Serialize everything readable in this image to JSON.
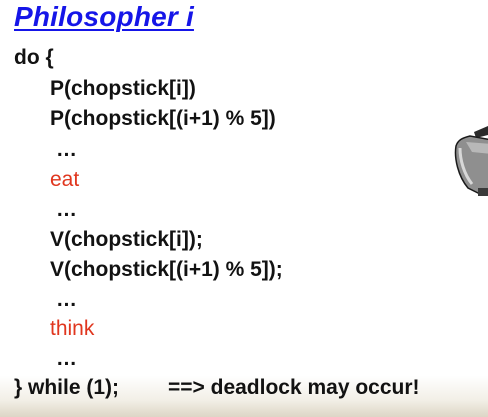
{
  "slide": {
    "title": "Philosopher i",
    "code": [
      {
        "text": "do {",
        "style": "code"
      },
      {
        "text": "P(chopstick[i])",
        "style": "code"
      },
      {
        "text": "P(chopstick[(i+1) % 5])",
        "style": "code"
      },
      {
        "text": "…",
        "style": "dots"
      },
      {
        "text": "eat",
        "style": "red"
      },
      {
        "text": "…",
        "style": "dots"
      },
      {
        "text": "V(chopstick[i]);",
        "style": "code"
      },
      {
        "text": "V(chopstick[(i+1) % 5]);",
        "style": "code"
      },
      {
        "text": "…",
        "style": "dots"
      },
      {
        "text": "think",
        "style": "red"
      },
      {
        "text": "…",
        "style": "dots"
      },
      {
        "text": "} while (1);",
        "style": "code"
      }
    ],
    "note": "==> deadlock may occur!",
    "side_image_icon": "chopstick-bowl-clipart-icon",
    "colors": {
      "title": "#1515e8",
      "code": "#121212",
      "highlight": "#e0361e"
    }
  }
}
